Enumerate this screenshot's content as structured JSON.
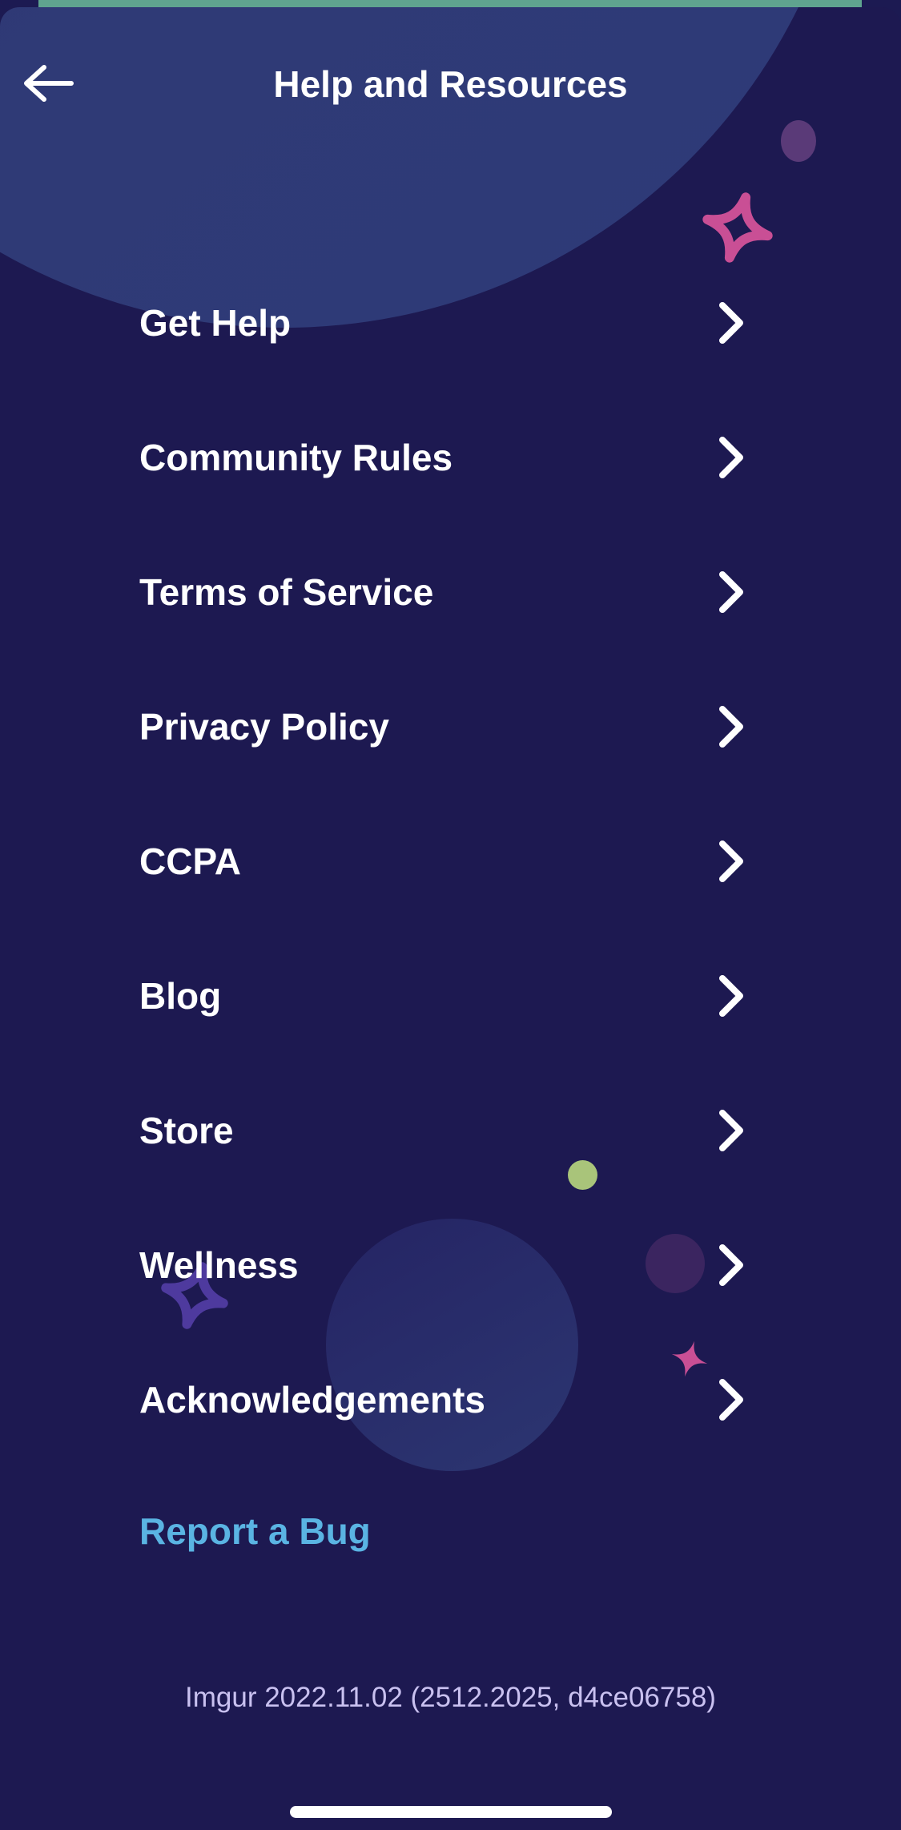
{
  "header": {
    "title": "Help and Resources",
    "back_icon": "arrow-left-icon"
  },
  "menu": {
    "items": [
      {
        "label": "Get Help",
        "icon": "chevron-right-icon"
      },
      {
        "label": "Community Rules",
        "icon": "chevron-right-icon"
      },
      {
        "label": "Terms of Service",
        "icon": "chevron-right-icon"
      },
      {
        "label": "Privacy Policy",
        "icon": "chevron-right-icon"
      },
      {
        "label": "CCPA",
        "icon": "chevron-right-icon"
      },
      {
        "label": "Blog",
        "icon": "chevron-right-icon"
      },
      {
        "label": "Store",
        "icon": "chevron-right-icon"
      },
      {
        "label": "Wellness",
        "icon": "chevron-right-icon"
      },
      {
        "label": "Acknowledgements",
        "icon": "chevron-right-icon"
      }
    ]
  },
  "report_bug": {
    "label": "Report a Bug"
  },
  "footer": {
    "version": "Imgur 2022.11.02 (2512.2025, d4ce06758)"
  },
  "colors": {
    "background": "#1d1951",
    "planet": "#2e3a78",
    "link_accent": "#5ab4e3",
    "sparkle_pink": "#c94f95",
    "sparkle_purple": "#4e3a9e",
    "dot_green": "#a9c47a"
  }
}
